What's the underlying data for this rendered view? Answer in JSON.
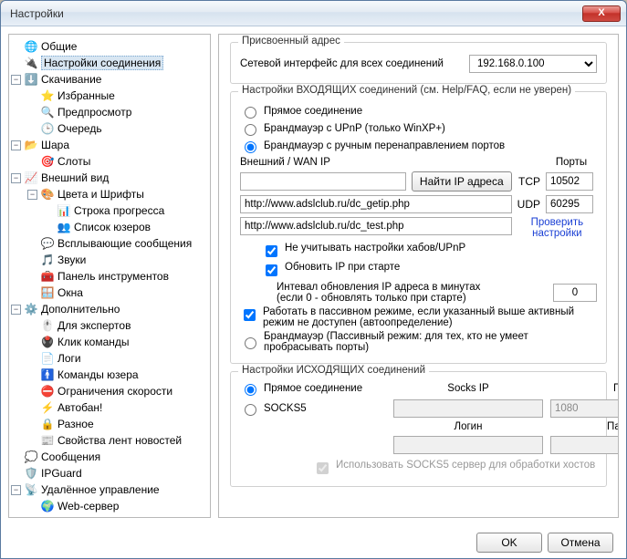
{
  "window": {
    "title": "Настройки"
  },
  "buttons": {
    "ok": "OK",
    "cancel": "Отмена",
    "close": "X"
  },
  "tree": [
    {
      "icon": "🌐",
      "label": "Общие"
    },
    {
      "icon": "🔌",
      "label": "Настройки соединения",
      "selected": true
    },
    {
      "icon": "⬇️",
      "label": "Скачивание",
      "exp": true,
      "children": [
        {
          "icon": "⭐",
          "label": "Избранные"
        },
        {
          "icon": "🔍",
          "label": "Предпросмотр"
        },
        {
          "icon": "🕒",
          "label": "Очередь"
        }
      ]
    },
    {
      "icon": "📂",
      "label": "Шара",
      "exp": true,
      "children": [
        {
          "icon": "🎯",
          "label": "Слоты"
        }
      ]
    },
    {
      "icon": "📈",
      "label": "Внешний вид",
      "exp": true,
      "children": [
        {
          "icon": "🎨",
          "label": "Цвета и Шрифты",
          "exp": true,
          "children": [
            {
              "icon": "📊",
              "label": "Строка прогресса"
            },
            {
              "icon": "👥",
              "label": "Список юзеров"
            }
          ]
        },
        {
          "icon": "💬",
          "label": "Всплывающие сообщения"
        },
        {
          "icon": "🎵",
          "label": "Звуки"
        },
        {
          "icon": "🧰",
          "label": "Панель инструментов"
        },
        {
          "icon": "🪟",
          "label": "Окна"
        }
      ]
    },
    {
      "icon": "⚙️",
      "label": "Дополнительно",
      "exp": true,
      "children": [
        {
          "icon": "🖱️",
          "label": "Для экспертов"
        },
        {
          "icon": "🖲️",
          "label": "Клик команды"
        },
        {
          "icon": "📄",
          "label": "Логи"
        },
        {
          "icon": "🚹",
          "label": "Команды юзера"
        },
        {
          "icon": "⛔",
          "label": "Ограничения скорости"
        },
        {
          "icon": "⚡",
          "label": "Автобан!"
        },
        {
          "icon": "🔒",
          "label": "Разное"
        },
        {
          "icon": "📰",
          "label": "Свойства лент новостей"
        }
      ]
    },
    {
      "icon": "💭",
      "label": "Сообщения"
    },
    {
      "icon": "🛡️",
      "label": "IPGuard"
    },
    {
      "icon": "📡",
      "label": "Удалённое управление",
      "exp": true,
      "children": [
        {
          "icon": "🌍",
          "label": "Web-сервер"
        }
      ]
    }
  ],
  "address": {
    "group": "Присвоенный адрес",
    "label": "Сетевой интерфейс для всех соединений",
    "value": "192.168.0.100"
  },
  "incoming": {
    "group": "Настройки ВХОДЯЩИХ соединений (см. Help/FAQ, если не уверен)",
    "opt_direct": "Прямое соединение",
    "opt_upnp": "Брандмауэр с UPnP (только WinXP+)",
    "opt_manual": "Брандмауэр с ручным перенаправлением портов",
    "wan_label": "Внешний / WAN IP",
    "ports_label": "Порты",
    "wan_ip": "",
    "find_ip": "Найти IP адреса",
    "tcp_label": "TCP",
    "tcp_port": "10502",
    "udp_label": "UDP",
    "udp_port": "60295",
    "url1": "http://www.adslclub.ru/dc_getip.php",
    "url2": "http://www.adslclub.ru/dc_test.php",
    "test_link1": "Проверить",
    "test_link2": "настройки",
    "chk_ignore": "Не учитывать настройки хабов/UPnP",
    "chk_update": "Обновить IP при старте",
    "interval_label": "Интевал обновления IP адреса в минутах\n(если 0 - обновлять только при старте)",
    "interval_val": "0",
    "chk_passive": "Работать в пассивном режиме, если указанный выше активный режим не доступен (автоопределение)",
    "opt_passive_fw": "Брандмауэр (Пассивный режим: для тех, кто не умеет пробрасывать порты)"
  },
  "outgoing": {
    "group": "Настройки ИСХОДЯЩИХ соединений",
    "opt_direct": "Прямое соединение",
    "opt_socks": "SOCKS5",
    "socks_ip_label": "Socks IP",
    "port_label": "Порт",
    "socks_ip": "",
    "port": "1080",
    "login_label": "Логин",
    "pass_label": "Пароль",
    "login": "",
    "pass": "",
    "chk_use_socks": "Использовать SOCKS5 сервер для обработки хостов"
  }
}
